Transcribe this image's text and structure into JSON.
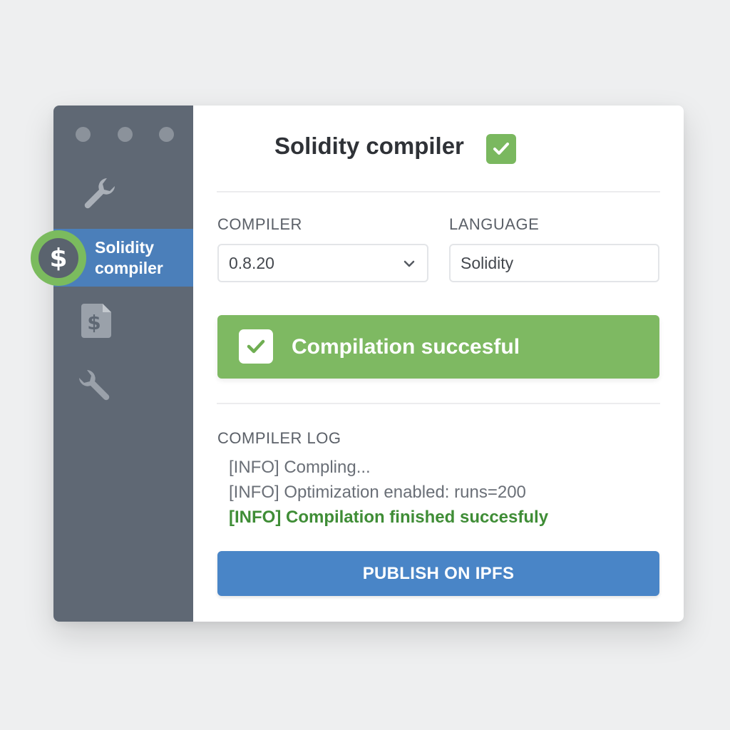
{
  "window": {
    "dots": [
      "dot",
      "dot",
      "dot"
    ]
  },
  "sidebar": {
    "items": [
      {
        "icon": "wrench-icon"
      },
      {
        "icon": "dollar-icon",
        "label": "Solidity compiler",
        "active": true
      },
      {
        "icon": "dollar-document-icon"
      },
      {
        "icon": "wrench-icon"
      }
    ],
    "active_label": "Solidity compiler",
    "active_badge_symbol": "$"
  },
  "main": {
    "title": "Solidity compiler",
    "compiler_label": "COMPILER",
    "compiler_value": "0.8.20",
    "language_label": "LANGUAGE",
    "language_value": "Solidity",
    "success_message": "Compilation succesful",
    "log_title": "COMPILER LOG",
    "log_lines": [
      "[INFO] Compling...",
      "[INFO] Optimization enabled: runs=200",
      "[INFO] Compilation finished succesfuly"
    ],
    "publish_label": "PUBLISH ON IPFS"
  },
  "colors": {
    "sidebar_bg": "#5f6874",
    "active_item_bg": "#4b7fba",
    "success_green": "#7eb962",
    "log_success_text": "#3f8d36",
    "primary_button": "#4985c7"
  }
}
